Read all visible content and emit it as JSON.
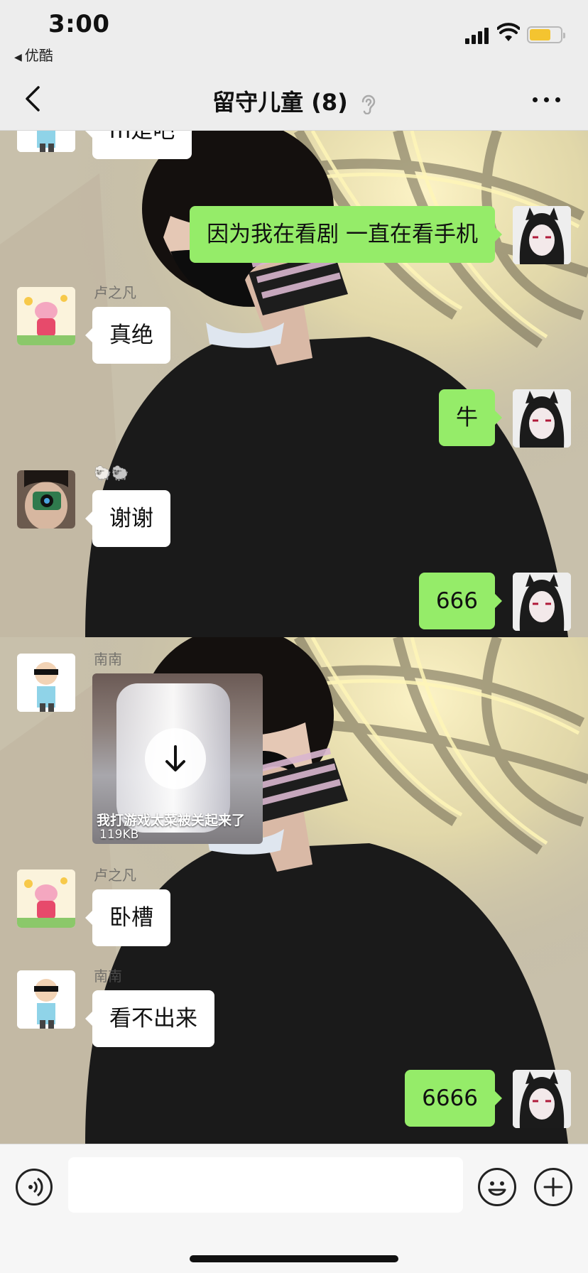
{
  "status_bar": {
    "time": "3:00",
    "back_app": "优酷"
  },
  "nav": {
    "title": "留守儿童 (8)",
    "icons": [
      "back-chevron-icon",
      "ear-icon",
      "more-dots-icon"
    ]
  },
  "messages": [
    {
      "side": "left",
      "sender": "",
      "text": "m是吧",
      "avatar": "cartoon-boy-avatar"
    },
    {
      "side": "right",
      "text": "因为我在看剧 一直在看手机",
      "avatar": "anime-girl-avatar"
    },
    {
      "side": "left",
      "sender": "卢之凡",
      "text": "真绝",
      "avatar": "pink-pig-avatar"
    },
    {
      "side": "right",
      "text": "牛",
      "avatar": "anime-girl-avatar"
    },
    {
      "side": "left",
      "sender": "🐑🐑",
      "text": "谢谢",
      "avatar": "camera-photo-avatar"
    },
    {
      "side": "right",
      "text": "666",
      "avatar": "anime-girl-avatar"
    },
    {
      "side": "left",
      "sender": "南南",
      "type": "video",
      "caption": "我打游戏太菜被关起来了",
      "size": "119KB",
      "avatar": "cartoon-boy-avatar"
    },
    {
      "side": "left",
      "sender": "卢之凡",
      "text": "卧槽",
      "avatar": "pink-pig-avatar"
    },
    {
      "side": "left",
      "sender": "南南",
      "text": "看不出来",
      "avatar": "cartoon-boy-avatar"
    },
    {
      "side": "right",
      "text": "6666",
      "avatar": "anime-girl-avatar"
    }
  ],
  "input_bar": {
    "value": "",
    "icons": [
      "voice-icon",
      "emoji-icon",
      "plus-icon"
    ]
  },
  "colors": {
    "bubble_self": "#95ec69",
    "bubble_other": "#ffffff",
    "bar_background": "#ededed",
    "battery": "#f4c430"
  }
}
